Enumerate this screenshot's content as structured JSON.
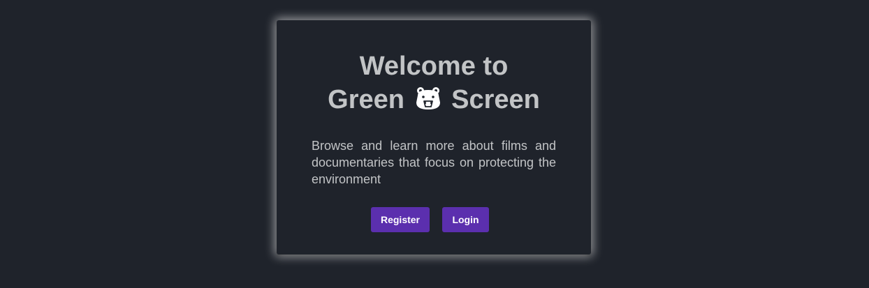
{
  "welcome": {
    "title_line1": "Welcome to",
    "title_part1": "Green",
    "title_part2": "Screen",
    "logo_icon": "polar-bear-icon",
    "description": "Browse and learn more about films and documentaries that focus on protecting the environment",
    "register_label": "Register",
    "login_label": "Login"
  },
  "colors": {
    "background": "#1f232b",
    "text": "#c2c4c6",
    "button": "#5b2fae",
    "button_text": "#ffffff"
  }
}
